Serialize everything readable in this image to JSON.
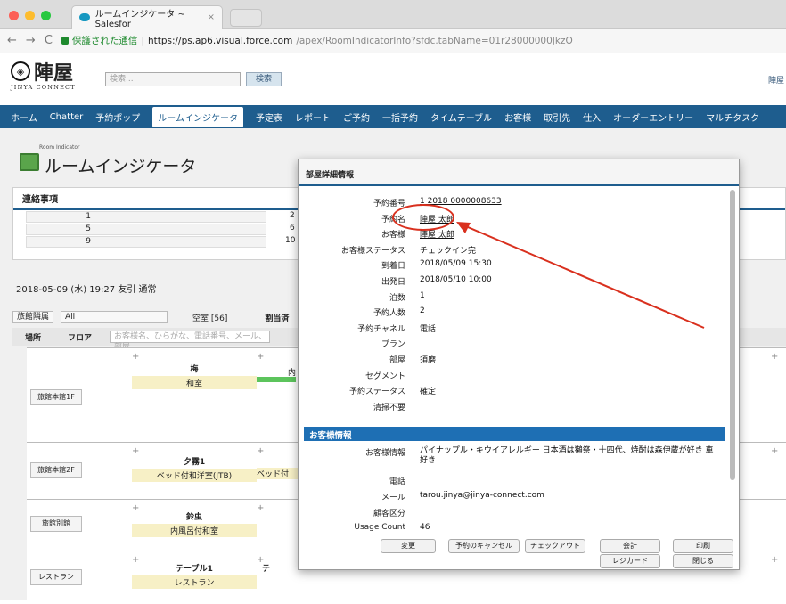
{
  "browser": {
    "tab_title": "ルームインジケータ ~ Salesfor",
    "tab_close": "×",
    "secure_label": "保護された通信",
    "url_host": "https://ps.ap6.visual.force.com",
    "url_path": "/apex/RoomIndicatorInfo?sfdc.tabName=01r28000000JkzO"
  },
  "header": {
    "logo_text": "陣屋",
    "logo_sub": "JINYA CONNECT",
    "search_placeholder": "検索...",
    "search_button": "検索",
    "right_link": "陣屋"
  },
  "nav": [
    "ホーム",
    "Chatter",
    "予約ポップ",
    "ルームインジケータ",
    "予定表",
    "レポート",
    "ご予約",
    "一括予約",
    "タイムテーブル",
    "お客様",
    "取引先",
    "仕入",
    "オーダーエントリー",
    "マルチタスク"
  ],
  "nav_active": "ルームインジケータ",
  "page": {
    "small_title": "Room Indicator",
    "title": "ルームインジケータ",
    "notes_title": "連絡事項",
    "notes_left": [
      "1",
      "5",
      "9"
    ],
    "notes_mid": [
      "2",
      "6",
      "10"
    ],
    "date_line": "2018-05-09 (水) 19:27 友引 通常",
    "filter1": "旅館隣属",
    "filter2": "All",
    "vacancy": "空室 [56]",
    "assigned": "割当済",
    "col_place": "場所",
    "col_floor": "フロア",
    "search_hint": "お客様名、ひらがな、電話番号、メール、部屋"
  },
  "grid": [
    {
      "place": "旅館本館1F",
      "room": "梅",
      "type": "和室"
    },
    {
      "place": "旅館本館2F",
      "room": "夕霧1",
      "type": "ベッド付和洋室(JTB)"
    },
    {
      "place": "旅館別館",
      "room": "鈴虫",
      "type": "内風呂付和室"
    },
    {
      "place": "レストラン",
      "room": "テーブル1",
      "type": "レストラン"
    }
  ],
  "grid_partial": [
    "内",
    "ベッド付",
    "テ"
  ],
  "modal": {
    "title": "部屋詳細情報",
    "fields": [
      {
        "label": "予約番号",
        "value": "1 2018 0000008633",
        "link": true
      },
      {
        "label": "予約名",
        "value": "陣屋 太郎",
        "link": true
      },
      {
        "label": "お客様",
        "value": "陣屋 太郎",
        "link": true
      },
      {
        "label": "お客様ステータス",
        "value": "チェックイン完"
      },
      {
        "label": "到着日",
        "value": "2018/05/09 15:30"
      },
      {
        "label": "出発日",
        "value": "2018/05/10 10:00"
      },
      {
        "label": "泊数",
        "value": "1"
      },
      {
        "label": "予約人数",
        "value": "2"
      },
      {
        "label": "予約チャネル",
        "value": "電話"
      },
      {
        "label": "プラン",
        "value": ""
      },
      {
        "label": "部屋",
        "value": "須磨"
      },
      {
        "label": "セグメント",
        "value": ""
      },
      {
        "label": "予約ステータス",
        "value": "確定"
      },
      {
        "label": "清掃不要",
        "value": ""
      }
    ],
    "section_title": "お客様情報",
    "customer_fields": [
      {
        "label": "お客様情報",
        "value": "パイナップル・キウイアレルギー 日本酒は獺祭・十四代、焼酎は森伊蔵が好き 車好き"
      },
      {
        "label": "電話",
        "value": ""
      },
      {
        "label": "メール",
        "value": "tarou.jinya@jinya-connect.com"
      },
      {
        "label": "顧客区分",
        "value": ""
      },
      {
        "label": "Usage Count",
        "value": "46"
      }
    ],
    "buttons": [
      "変更",
      "予約のキャンセル",
      "チェックアウト",
      "会計",
      "印刷",
      "レジカード",
      "閉じる"
    ]
  },
  "annotation_color": "#d9301e"
}
